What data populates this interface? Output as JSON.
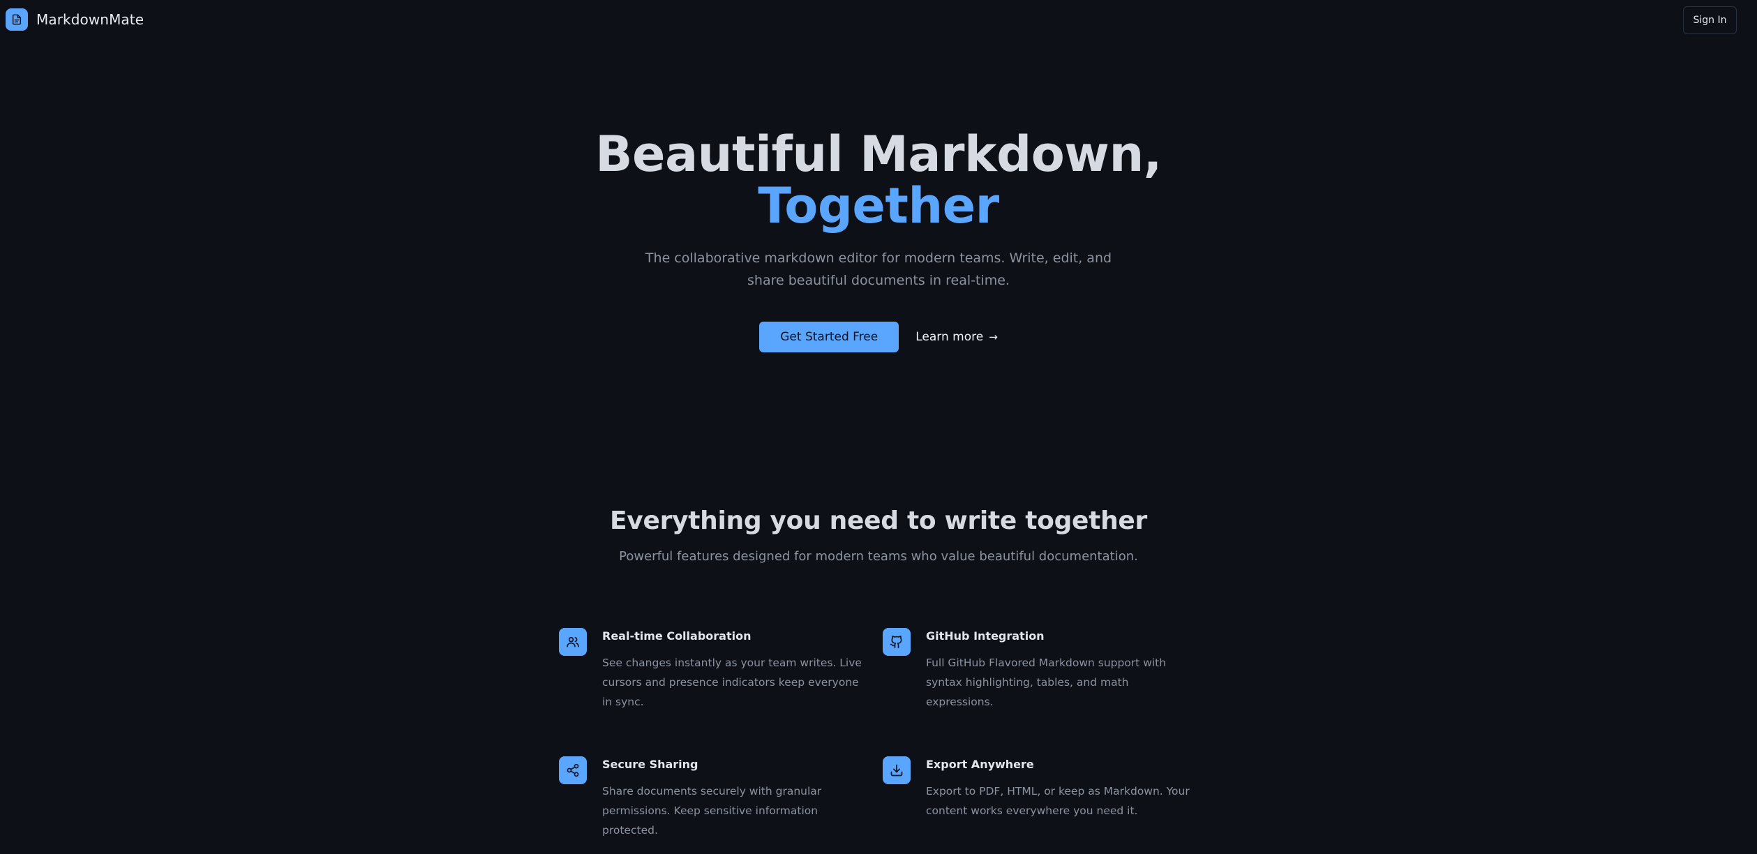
{
  "brand": {
    "name": "MarkdownMate",
    "logo_icon": "document-icon",
    "accent_color": "#5aa6ff"
  },
  "nav": {
    "signin_label": "Sign In"
  },
  "hero": {
    "title_line1": "Beautiful Markdown,",
    "title_line2": "Together",
    "subtitle": "The collaborative markdown editor for modern teams. Write, edit, and share beautiful documents in real-time.",
    "primary_cta": "Get Started Free",
    "secondary_cta": "Learn more",
    "secondary_arrow": "→"
  },
  "features": {
    "title": "Everything you need to write together",
    "subtitle": "Powerful features designed for modern teams who value beautiful documentation.",
    "items": [
      {
        "icon": "users-icon",
        "title": "Real-time Collaboration",
        "description": "See changes instantly as your team writes. Live cursors and presence indicators keep everyone in sync."
      },
      {
        "icon": "github-icon",
        "title": "GitHub Integration",
        "description": "Full GitHub Flavored Markdown support with syntax highlighting, tables, and math expressions."
      },
      {
        "icon": "share-icon",
        "title": "Secure Sharing",
        "description": "Share documents securely with granular permissions. Keep sensitive information protected."
      },
      {
        "icon": "download-icon",
        "title": "Export Anywhere",
        "description": "Export to PDF, HTML, or keep as Markdown. Your content works everywhere you need it."
      }
    ]
  }
}
